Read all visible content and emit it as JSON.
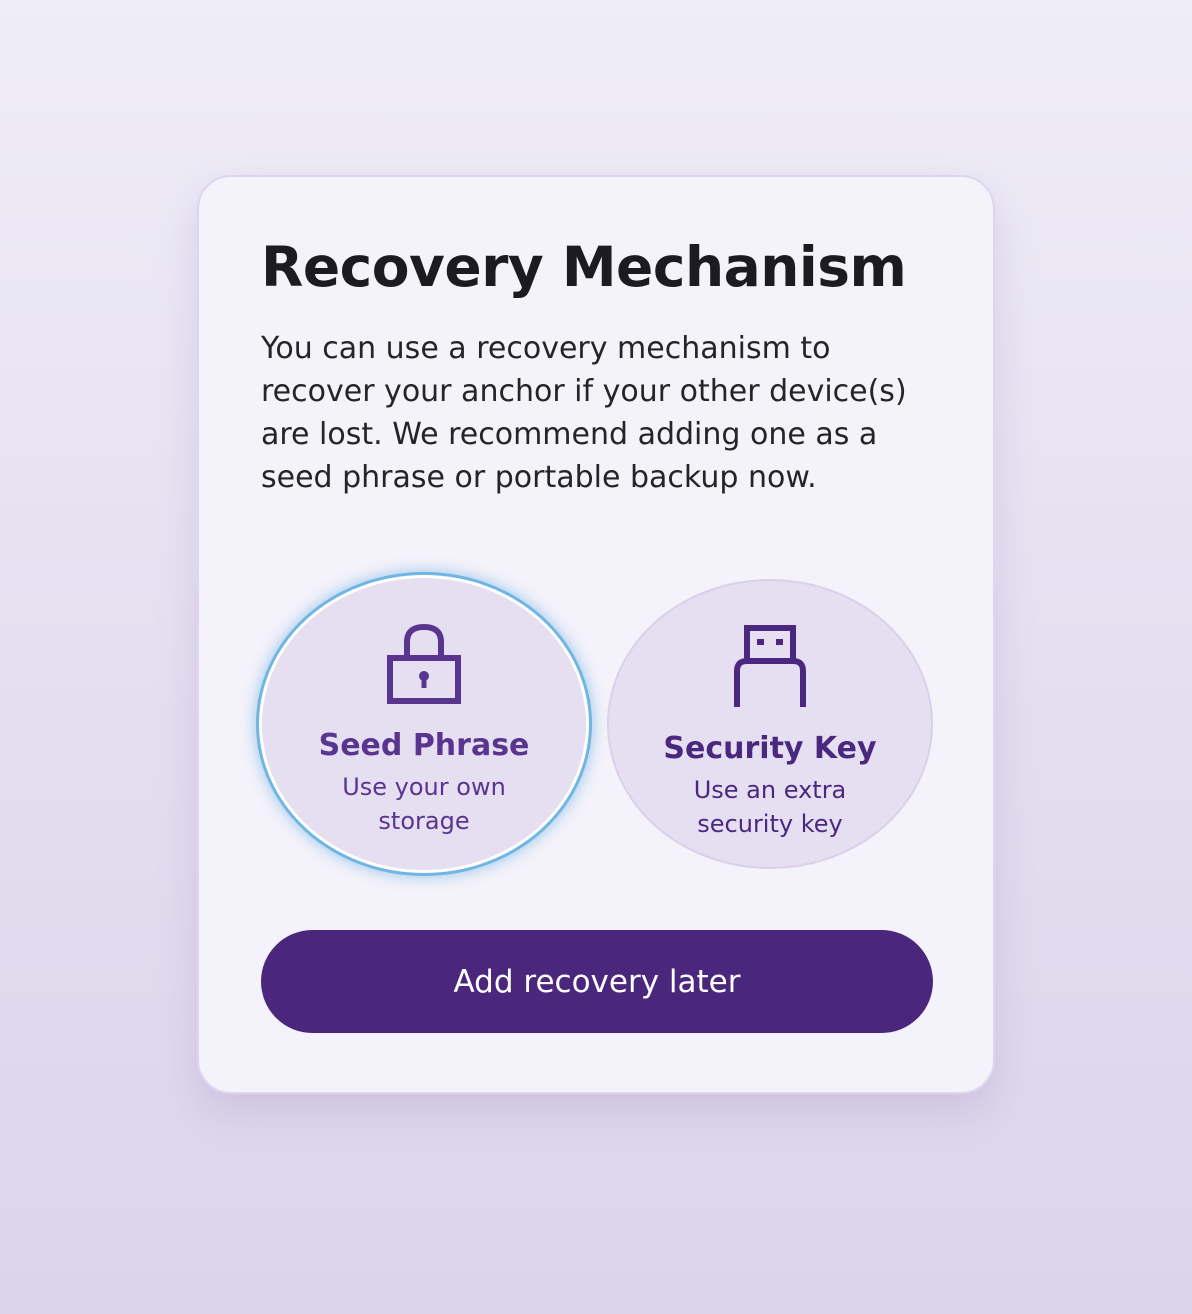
{
  "card": {
    "title": "Recovery Mechanism",
    "description": "You can use a recovery mechanism to recover your anchor if your other device(s) are lost. We recommend adding one as a seed phrase or portable backup now."
  },
  "options": [
    {
      "title": "Seed Phrase",
      "subtitle": "Use your own storage",
      "icon": "lock-icon",
      "selected": true
    },
    {
      "title": "Security Key",
      "subtitle": "Use an extra security key",
      "icon": "usb-key-icon",
      "selected": false
    }
  ],
  "actions": {
    "later_label": "Add recovery later"
  },
  "colors": {
    "accent": "#4a267d",
    "option_text": "#5a3590",
    "focus_ring": "#6fb7e2",
    "card_bg": "#f4f2fa"
  }
}
